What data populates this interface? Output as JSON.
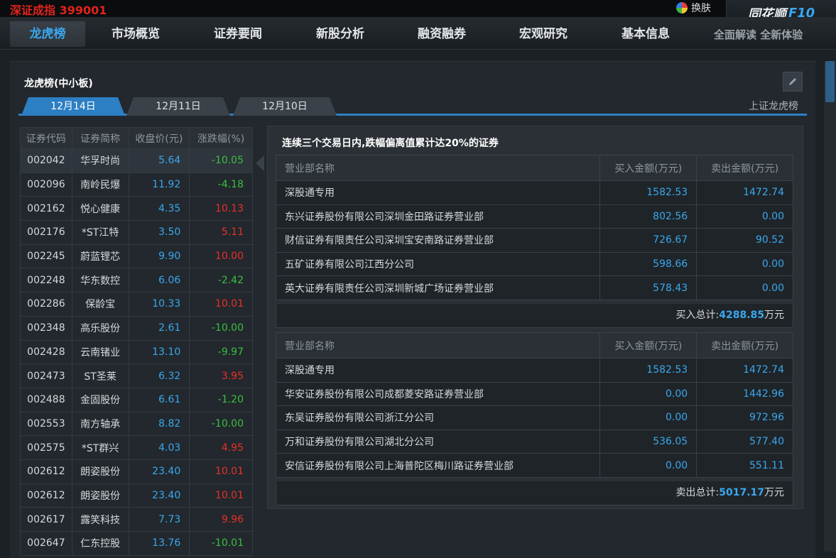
{
  "topbar": {
    "index_name": "深证成指",
    "index_value": "399001",
    "skin_label": "换肤",
    "logo_text": "同花顺",
    "logo_suffix": "F10"
  },
  "nav": {
    "tabs": [
      {
        "label": "龙虎榜"
      },
      {
        "label": "市场概览"
      },
      {
        "label": "证券要闻"
      },
      {
        "label": "新股分析"
      },
      {
        "label": "融资融券"
      },
      {
        "label": "宏观研究"
      },
      {
        "label": "基本信息"
      }
    ],
    "promo": "全面解读 全新体验"
  },
  "section": {
    "title": "龙虎榜(中小板)",
    "date_tabs": [
      {
        "label": "12月14日"
      },
      {
        "label": "12月11日"
      },
      {
        "label": "12月10日"
      }
    ],
    "sh_link": "上证龙虎榜"
  },
  "stock_table": {
    "headers": [
      "证券代码",
      "证券简称",
      "收盘价(元)",
      "涨跌幅(%)"
    ],
    "rows": [
      {
        "code": "002042",
        "name": "华孚时尚",
        "price": "5.64",
        "change": "-10.05"
      },
      {
        "code": "002096",
        "name": "南岭民爆",
        "price": "11.92",
        "change": "-4.18"
      },
      {
        "code": "002162",
        "name": "悦心健康",
        "price": "4.35",
        "change": "10.13"
      },
      {
        "code": "002176",
        "name": "*ST江特",
        "price": "3.50",
        "change": "5.11"
      },
      {
        "code": "002245",
        "name": "蔚蓝锂芯",
        "price": "9.90",
        "change": "10.00"
      },
      {
        "code": "002248",
        "name": "华东数控",
        "price": "6.06",
        "change": "-2.42"
      },
      {
        "code": "002286",
        "name": "保龄宝",
        "price": "10.33",
        "change": "10.01"
      },
      {
        "code": "002348",
        "name": "高乐股份",
        "price": "2.61",
        "change": "-10.00"
      },
      {
        "code": "002428",
        "name": "云南锗业",
        "price": "13.10",
        "change": "-9.97"
      },
      {
        "code": "002473",
        "name": "ST圣莱",
        "price": "6.32",
        "change": "3.95"
      },
      {
        "code": "002488",
        "name": "金固股份",
        "price": "6.61",
        "change": "-1.20"
      },
      {
        "code": "002553",
        "name": "南方轴承",
        "price": "8.82",
        "change": "-10.00"
      },
      {
        "code": "002575",
        "name": "*ST群兴",
        "price": "4.03",
        "change": "4.95"
      },
      {
        "code": "002612",
        "name": "朗姿股份",
        "price": "23.40",
        "change": "10.01"
      },
      {
        "code": "002612",
        "name": "朗姿股份",
        "price": "23.40",
        "change": "10.01"
      },
      {
        "code": "002617",
        "name": "露笑科技",
        "price": "7.73",
        "change": "9.96"
      },
      {
        "code": "002647",
        "name": "仁东控股",
        "price": "13.76",
        "change": "-10.01"
      }
    ]
  },
  "detail": {
    "title": "连续三个交易日内,跌幅偏离值累计达20%的证券",
    "buy": {
      "headers": [
        "营业部名称",
        "买入金额(万元)",
        "卖出金额(万元)"
      ],
      "rows": [
        {
          "name": "深股通专用",
          "buy": "1582.53",
          "sell": "1472.74"
        },
        {
          "name": "东兴证券股份有限公司深圳金田路证券营业部",
          "buy": "802.56",
          "sell": "0.00"
        },
        {
          "name": "财信证券有限责任公司深圳宝安南路证券营业部",
          "buy": "726.67",
          "sell": "90.52"
        },
        {
          "name": "五矿证券有限公司江西分公司",
          "buy": "598.66",
          "sell": "0.00"
        },
        {
          "name": "英大证券有限责任公司深圳新城广场证券营业部",
          "buy": "578.43",
          "sell": "0.00"
        }
      ],
      "total_label": "买入总计:",
      "total_value": "4288.85",
      "total_unit": "万元"
    },
    "sell": {
      "headers": [
        "营业部名称",
        "买入金额(万元)",
        "卖出金额(万元)"
      ],
      "rows": [
        {
          "name": "深股通专用",
          "buy": "1582.53",
          "sell": "1472.74"
        },
        {
          "name": "华安证券股份有限公司成都菱安路证券营业部",
          "buy": "0.00",
          "sell": "1442.96"
        },
        {
          "name": "东吴证券股份有限公司浙江分公司",
          "buy": "0.00",
          "sell": "972.96"
        },
        {
          "name": "万和证券股份有限公司湖北分公司",
          "buy": "536.05",
          "sell": "577.40"
        },
        {
          "name": "安信证券股份有限公司上海普陀区梅川路证券营业部",
          "buy": "0.00",
          "sell": "551.11"
        }
      ],
      "total_label": "卖出总计:",
      "total_value": "5017.17",
      "total_unit": "万元"
    }
  },
  "colors": {
    "accent": "#3aa7ee",
    "up": "#e8302a",
    "down": "#3cbf3f",
    "index": "#e0241b"
  }
}
